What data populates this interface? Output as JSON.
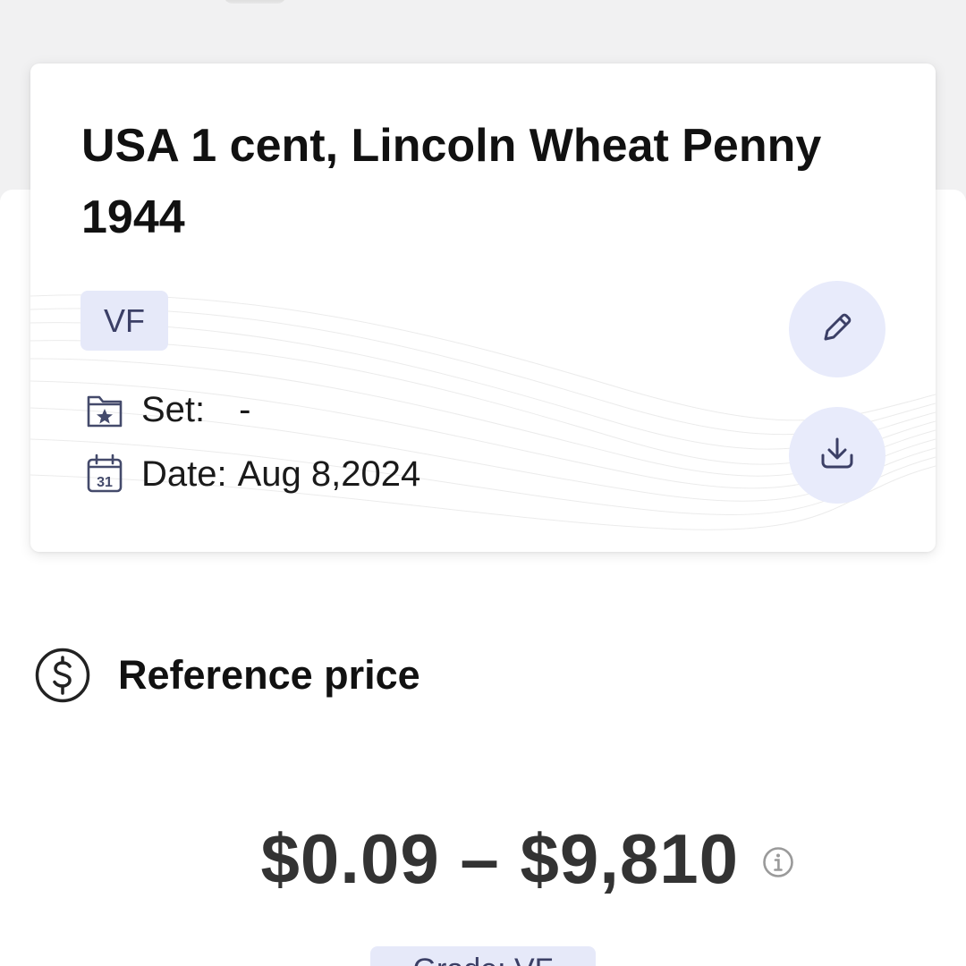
{
  "coin_card": {
    "title": "USA 1 cent, Lincoln Wheat Penny 1944",
    "grade_chip": "VF",
    "set": {
      "label": "Set:",
      "value": "-",
      "icon": "folder-star-icon"
    },
    "date": {
      "label": "Date:",
      "value": "Aug 8,2024",
      "icon": "calendar-icon",
      "icon_day": "31"
    },
    "actions": {
      "edit_icon": "pencil-icon",
      "download_icon": "download-icon"
    }
  },
  "reference_price": {
    "heading": "Reference price",
    "icon": "dollar-circle-icon",
    "range": "$0.09 – $9,810",
    "info_icon": "info-icon",
    "grade_pill": "Grade: VF"
  },
  "colors": {
    "accent_soft": "#e8ebfb",
    "accent_text": "#3b3f66",
    "text_primary": "#111111",
    "price_text": "#333333"
  }
}
